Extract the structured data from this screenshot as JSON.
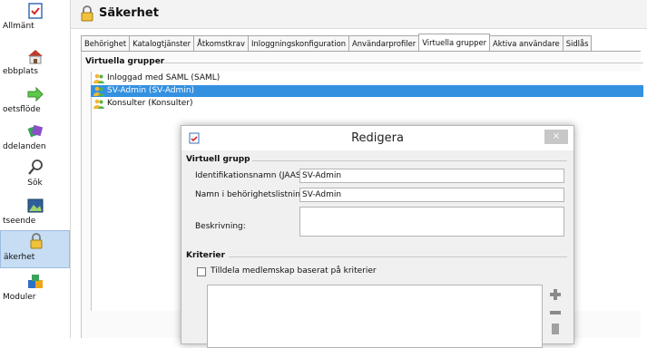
{
  "nav": {
    "items": [
      {
        "label": "Allmänt",
        "icon": "checklist-icon"
      },
      {
        "label": "ebbplats",
        "icon": "house-icon"
      },
      {
        "label": "oetsflöde",
        "icon": "arrow-right-icon"
      },
      {
        "label": "ddelanden",
        "icon": "notes-icon"
      },
      {
        "label": "Sök",
        "icon": "magnifier-icon"
      },
      {
        "label": "tseende",
        "icon": "picture-icon"
      },
      {
        "label": "äkerhet",
        "icon": "padlock-icon"
      },
      {
        "label": "Moduler",
        "icon": "blocks-icon"
      }
    ],
    "selected_index": 6
  },
  "header": {
    "title": "Säkerhet"
  },
  "tabs": [
    "Behörighet",
    "Katalogtjänster",
    "Åtkomstkrav",
    "Inloggningskonfiguration",
    "Användarprofiler",
    "Virtuella grupper",
    "Aktiva användare",
    "Sidlås"
  ],
  "active_tab": "Virtuella grupper",
  "groups": {
    "title": "Virtuella grupper",
    "items": [
      {
        "label": "Inloggad med SAML (SAML)",
        "selected": false
      },
      {
        "label": "SV-Admin (SV-Admin)",
        "selected": true
      },
      {
        "label": "Konsulter (Konsulter)",
        "selected": false
      }
    ]
  },
  "dialog": {
    "title": "Redigera",
    "close_label": "×",
    "section1": "Virtuell grupp",
    "id_label": "Identifikationsnamn (JAAS):",
    "id_value": "SV-Admin",
    "name_label": "Namn i behörighetslistning:",
    "name_value": "SV-Admin",
    "desc_label": "Beskrivning:",
    "section2": "Kriterier",
    "checkbox_label": "Tilldela medlemskap baserat på kriterier",
    "checkbox_checked": false
  },
  "colors": {
    "selection": "#3391e0",
    "nav_selected": "#c6ddf4"
  }
}
